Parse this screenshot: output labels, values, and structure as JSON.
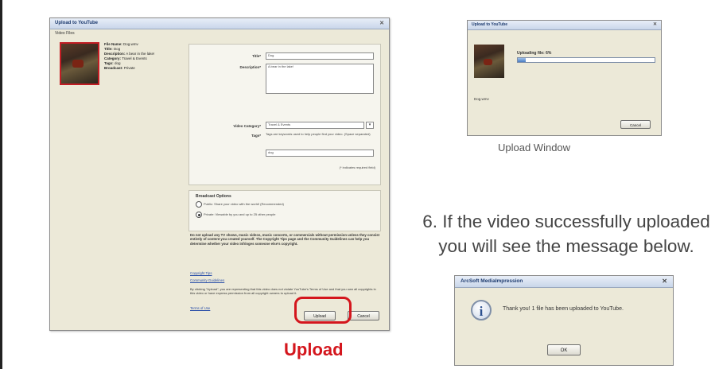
{
  "main_dialog": {
    "title": "Upload to YouTube",
    "group_label": "Video Files",
    "meta": [
      {
        "key": "File Name:",
        "value": "Dog.wmv"
      },
      {
        "key": "Title:",
        "value": "Dog"
      },
      {
        "key": "Description:",
        "value": "A bear in the lake!"
      },
      {
        "key": "Category:",
        "value": "Travel & Events"
      },
      {
        "key": "Tags:",
        "value": "dog"
      },
      {
        "key": "Broadcast:",
        "value": "Private"
      }
    ],
    "fields": {
      "title_label": "Title*",
      "title_value": "Dog",
      "description_label": "Description*",
      "description_value": "A bear in the lake!",
      "category_label": "Video Category*",
      "category_value": "Travel & Events",
      "tags_label": "Tags*",
      "tags_help": "Tags are keywords used to help people find your video. (Space separated)",
      "tags_value": "dog",
      "required_note": "(* indicates required field)"
    },
    "broadcast": {
      "heading": "Broadcast Options",
      "option_public": "Public: Share your video with the world! (Recommended)",
      "option_private": "Private: Viewable by you and up to 25 other people"
    },
    "legal_text": "Do not upload any TV shows, music videos, music concerts, or commercials without permission unless they consist entirely of content you created yourself. The Copyright Tips page and the Community Guidelines can help you determine whether your video infringes someone else's copyright.",
    "link_copyright": "Copyright Tips",
    "link_guidelines": "Community Guidelines",
    "agreement_text": "By clicking \"Upload\", you are representing that this video does not violate YouTube's Terms of Use and that you own all copyrights in this video or have express permission from all copyright owners to upload it.",
    "link_terms": "Terms of Use",
    "upload_button": "Upload",
    "cancel_button": "Cancel"
  },
  "upload_caption": "Upload",
  "upload_window": {
    "title": "Upload to YouTube",
    "status": "Uploading file: 6%",
    "progress": 0.06,
    "thumb_label": "Dog.wmv",
    "cancel_button": "Cancel",
    "caption": "Upload Window"
  },
  "step_text": {
    "line1": "6. If the video successfully uploaded",
    "line2": "you will see the message below."
  },
  "message_box": {
    "title": "ArcSoft MediaImpression",
    "icon": "i",
    "message": "Thank you! 1 file has been uploaded to YouTube.",
    "ok_button": "OK"
  }
}
